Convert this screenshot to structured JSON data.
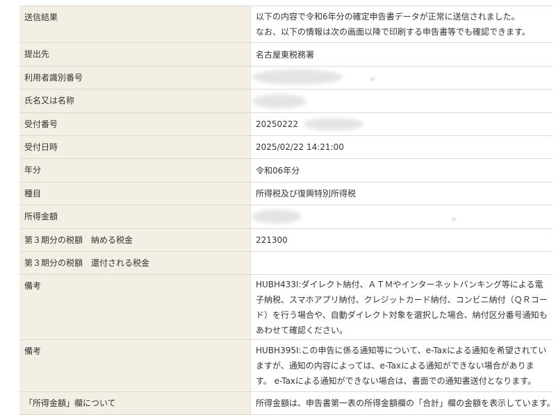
{
  "colors": {
    "label_bg": "#f4efe4",
    "text": "#333333",
    "border": "#dcd8d0"
  },
  "result_table": {
    "rows": [
      {
        "label": "送信結果",
        "lines": [
          "以下の内容で令和6年分の確定申告書データが正常に送信されました。",
          "なお、以下の情報は次の画面以降で印刷する申告書等でも確認できます。"
        ]
      },
      {
        "label": "提出先",
        "value": "名古屋東税務署"
      },
      {
        "label": "利用者識別番号"
      },
      {
        "label": "氏名又は名称"
      },
      {
        "label": "受付番号",
        "value": "20250222"
      },
      {
        "label": "受付日時",
        "value": "2025/02/22 14:21:00"
      },
      {
        "label": "年分",
        "value": "令和06年分"
      },
      {
        "label": "種目",
        "value": "所得税及び復興特別所得税"
      },
      {
        "label": "所得金額"
      },
      {
        "label": "第３期分の税額　納める税金",
        "value": "221300"
      },
      {
        "label": "第３期分の税額　還付される税金"
      },
      {
        "label": "備考",
        "value": "HUBH433I:ダイレクト納付、ＡＴＭやインターネットバンキング等による電子納税、スマホアプリ納付、クレジットカード納付、コンビニ納付（ＱＲコード）を行う場合や、自動ダイレクト対象を選択した場合、納付区分番号通知もあわせて確認ください。"
      },
      {
        "label": "備考",
        "value": "HUBH395I:この申告に係る通知等について、e-Taxによる通知を希望されていますが、通知の内容によっては、e-Taxによる通知ができない場合があります。 e-Taxによる通知ができない場合は、書面での通知書送付となります。"
      },
      {
        "label": "「所得金額」欄について",
        "value": "所得金額は、申告書第一表の所得金額欄の「合計」欄の金額を表示しています。"
      }
    ]
  }
}
